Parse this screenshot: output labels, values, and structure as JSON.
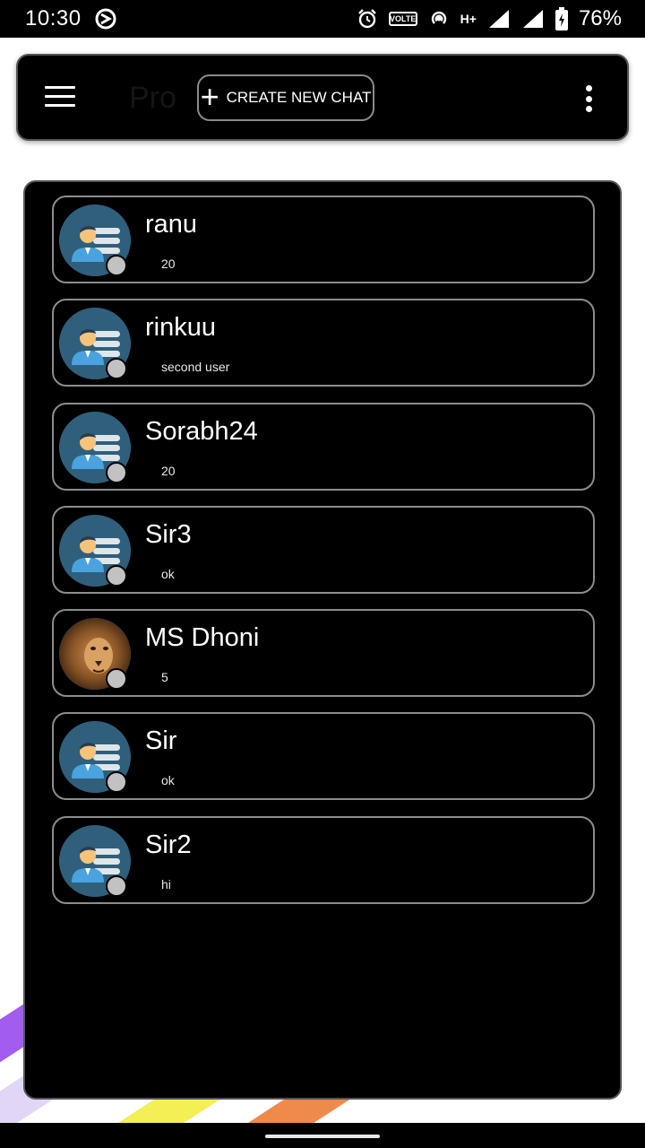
{
  "status_bar": {
    "time": "10:30",
    "volte": "VOLTE",
    "network": "H+",
    "battery": "76%"
  },
  "app_bar": {
    "ghost_title": "Pro",
    "create_button_label": "CREATE NEW CHAT"
  },
  "chats": [
    {
      "name": "ranu",
      "message": "20",
      "avatar": "default-user-icon"
    },
    {
      "name": "rinkuu",
      "message": "second user",
      "avatar": "default-user-icon"
    },
    {
      "name": "Sorabh24",
      "message": "20",
      "avatar": "default-user-icon"
    },
    {
      "name": "Sir3",
      "message": "ok",
      "avatar": "default-user-icon"
    },
    {
      "name": "MS Dhoni",
      "message": "5",
      "avatar": "lion-photo"
    },
    {
      "name": "Sir",
      "message": "ok",
      "avatar": "default-user-icon"
    },
    {
      "name": "Sir2",
      "message": "hi",
      "avatar": "default-user-icon"
    }
  ],
  "colors": {
    "background": "#ffffff",
    "panel": "#000000",
    "avatar_bg": "#2f5f7b",
    "status_dot": "#c2c2c2",
    "stripe_purple": "#a35cf0",
    "stripe_lilac": "#e2d6f6",
    "stripe_yellow": "#f3ef55",
    "stripe_orange": "#f08a4b"
  }
}
